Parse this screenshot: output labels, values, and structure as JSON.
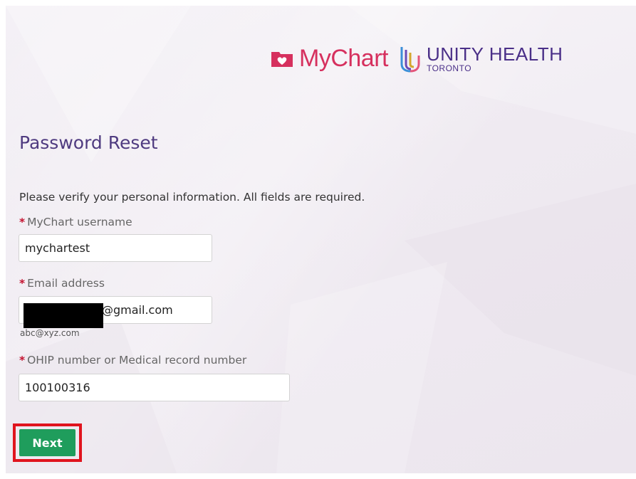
{
  "header": {
    "mychart_logo_text": "MyChart",
    "unity_logo_main": "UNITY HEALTH",
    "unity_logo_sub": "TORONTO"
  },
  "page": {
    "title": "Password Reset",
    "instructions": "Please verify your personal information. All fields are required."
  },
  "form": {
    "required_marker": "*",
    "username": {
      "label": "MyChart username",
      "value": "mychartest"
    },
    "email": {
      "label": "Email address",
      "value": "@gmail.com",
      "hint": "abc@xyz.com"
    },
    "id_number": {
      "label": "OHIP number or Medical record number",
      "value": "100100316"
    },
    "next_label": "Next"
  },
  "colors": {
    "title": "#4f3b80",
    "required": "#c4122f",
    "button": "#1f9d5c",
    "highlight_border": "#e0141e",
    "mychart_brand": "#d6305e",
    "unity_brand": "#4a2f88"
  }
}
